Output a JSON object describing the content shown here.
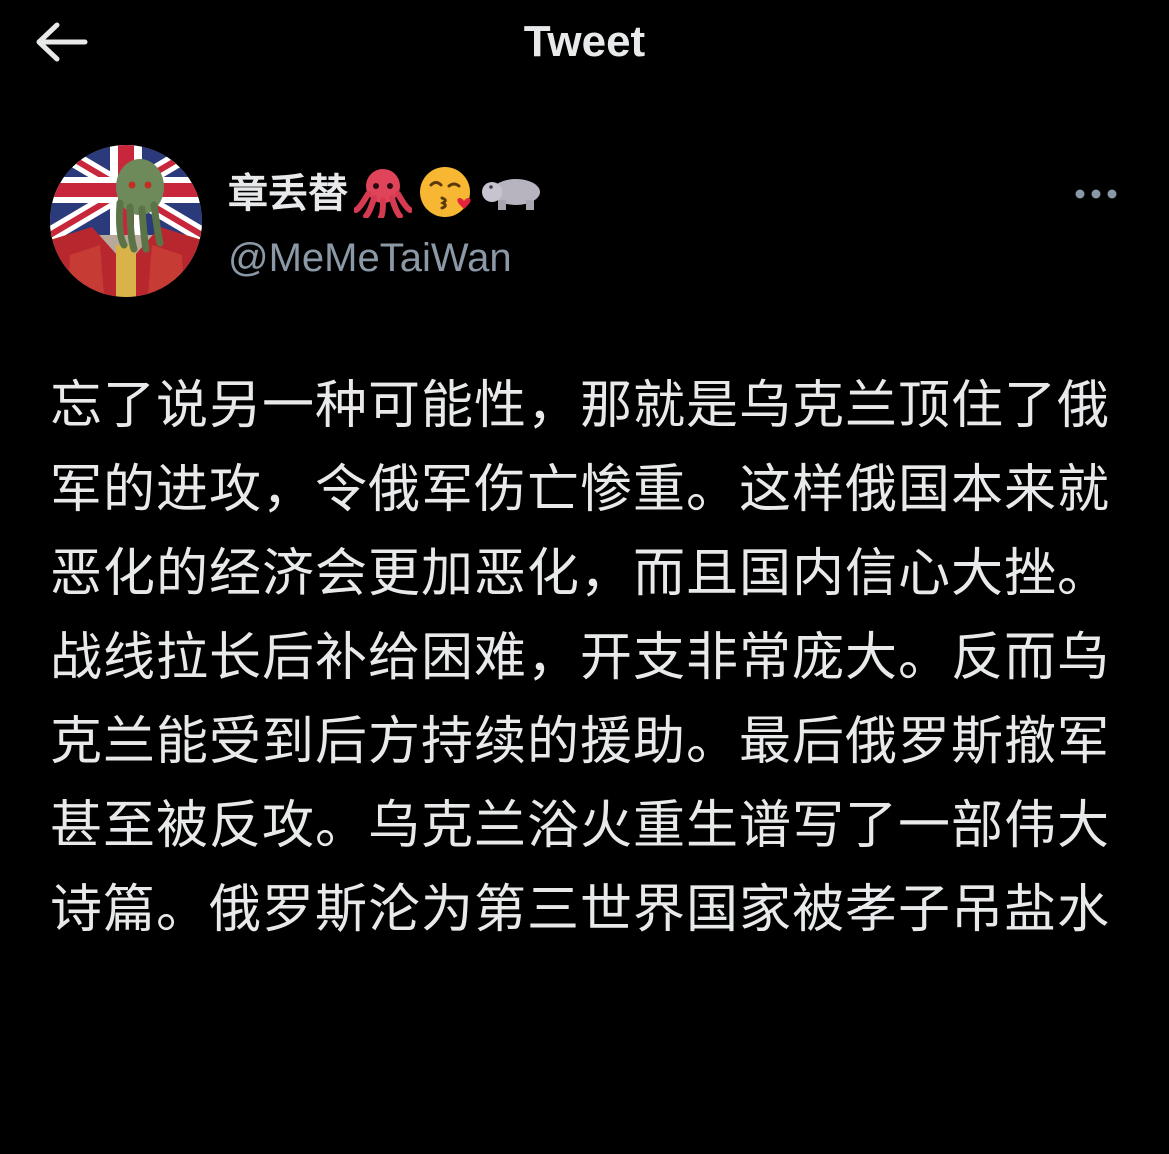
{
  "header": {
    "title": "Tweet",
    "back_icon": "arrow-left-icon"
  },
  "tweet": {
    "author": {
      "display_name": "章丢替",
      "name_emojis": [
        "octopus-icon",
        "kissing-face-icon",
        "hippo-icon"
      ],
      "handle": "@MeMeTaiWan"
    },
    "more_icon": "ellipsis-icon",
    "text": "忘了说另一种可能性，那就是乌克兰顶住了俄军的进攻，令俄军伤亡惨重。这样俄国本来就恶化的经济会更加恶化，而且国内信心大挫。战线拉长后补给困难，开支非常庞大。反而乌克兰能受到后方持续的援助。最后俄罗斯撤军甚至被反攻。乌克兰浴火重生谱写了一部伟大诗篇。俄罗斯沦为第三世界国家被孝子吊盐水"
  },
  "colors": {
    "background": "#000000",
    "primary_text": "#e7e9ea",
    "secondary_text": "#8b98a5"
  }
}
